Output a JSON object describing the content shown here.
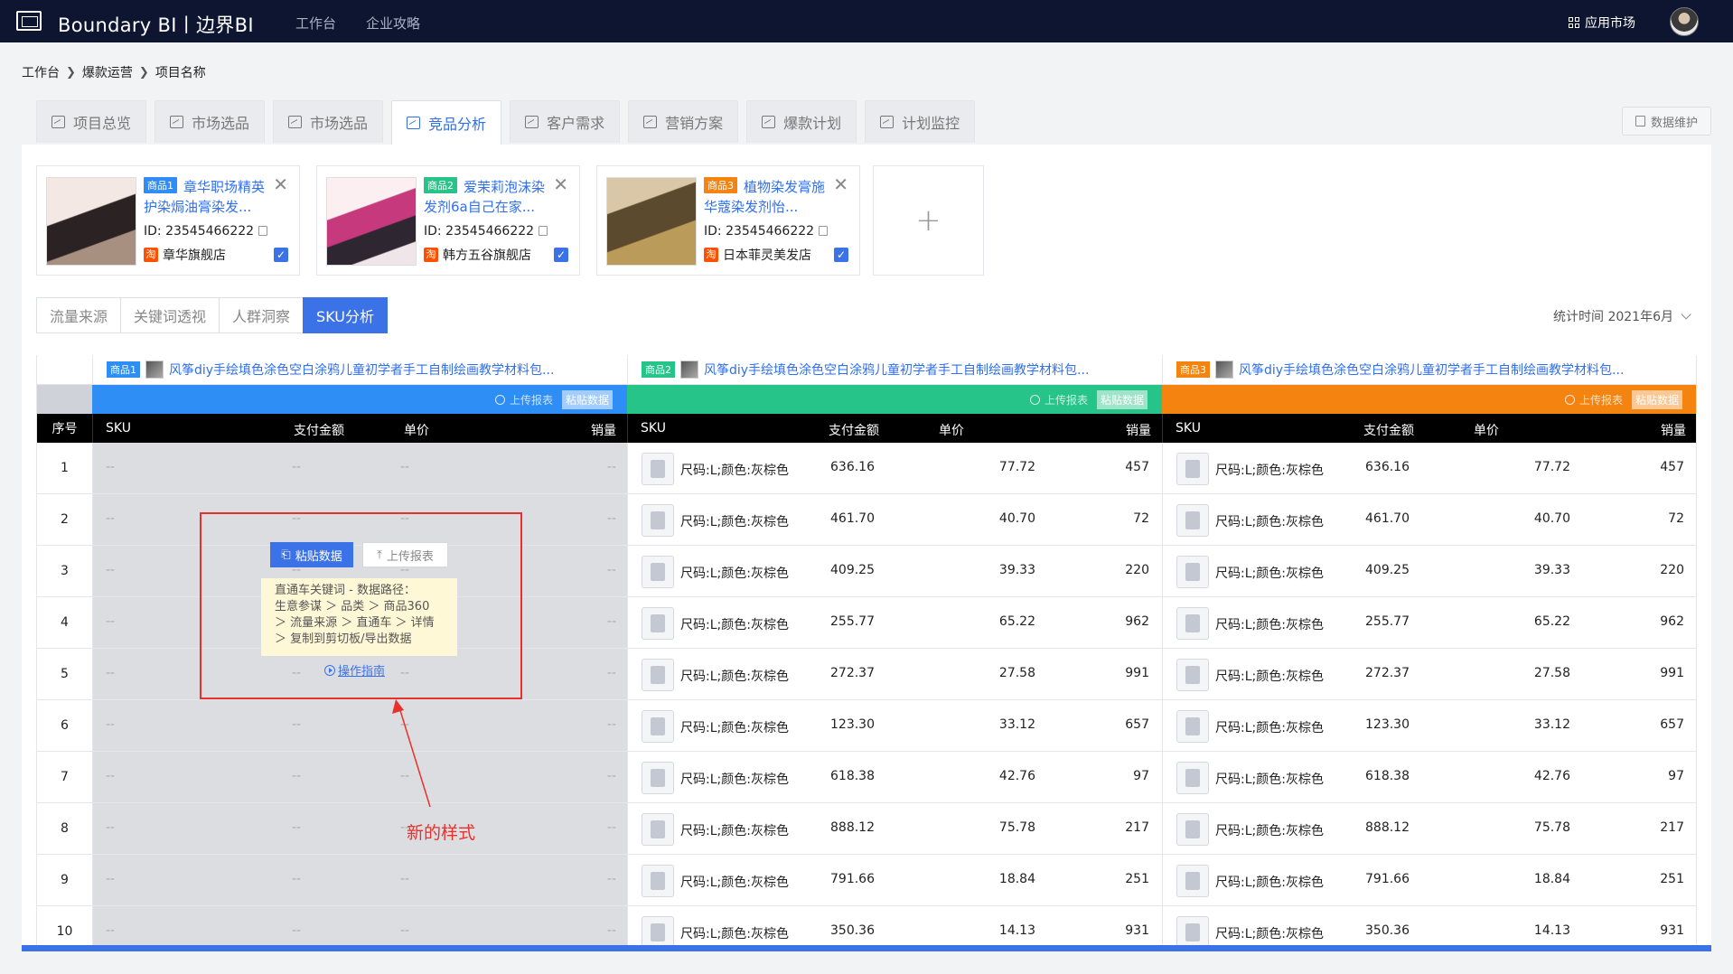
{
  "app": {
    "brand": "Boundary BI丨边界BI",
    "nav": [
      "工作台",
      "企业攻略"
    ],
    "app_market": "应用市场"
  },
  "breadcrumb": [
    "工作台",
    "爆款运营",
    "项目名称"
  ],
  "main_tabs": [
    {
      "label": "项目总览"
    },
    {
      "label": "市场选品"
    },
    {
      "label": "市场选品"
    },
    {
      "label": "竞品分析",
      "active": true
    },
    {
      "label": "客户需求"
    },
    {
      "label": "营销方案"
    },
    {
      "label": "爆款计划"
    },
    {
      "label": "计划监控"
    }
  ],
  "maintenance_button": "数据维护",
  "products": [
    {
      "tag": "商品1",
      "tag_color": "#2f8ef5",
      "title": "章华职场精英护染焗油膏染发...",
      "id": "ID: 23545466222",
      "shop": "章华旗舰店"
    },
    {
      "tag": "商品2",
      "tag_color": "#27c48a",
      "title": "爱茉莉泡沫染发剂6a自己在家...",
      "id": "ID: 23545466222",
      "shop": "韩方五谷旗舰店"
    },
    {
      "tag": "商品3",
      "tag_color": "#f5830f",
      "title": "植物染发膏施华蔻染发剂怡...",
      "id": "ID: 23545466222",
      "shop": "日本菲灵美发店"
    }
  ],
  "taobao_icon_text": "淘",
  "add_product": "+",
  "sub_tabs": [
    {
      "label": "流量来源"
    },
    {
      "label": "关键词透视"
    },
    {
      "label": "人群洞察"
    },
    {
      "label": "SKU分析",
      "active": true
    }
  ],
  "stat_time": "统计时间 2021年6月",
  "table": {
    "seq_header": "序号",
    "columns": [
      "SKU",
      "支付金额",
      "单价",
      "销量"
    ],
    "group_title": "风筝diy手绘填色涂色空白涂鸦儿童初学者手工自制绘画教学材料包...",
    "upload_label": "上传报表",
    "paste_label": "粘贴数据",
    "empty_mark": "--",
    "groups": [
      {
        "tag": "商品1",
        "color": "#2f8ef5",
        "empty": true
      },
      {
        "tag": "商品2",
        "color": "#27c48a",
        "empty": false
      },
      {
        "tag": "商品3",
        "color": "#f5830f",
        "empty": false
      }
    ],
    "rows": [
      {
        "seq": "1",
        "sku": "尺码:L;颜色:灰棕色",
        "amount": "636.16",
        "price": "77.72",
        "sales": "457"
      },
      {
        "seq": "2",
        "sku": "尺码:L;颜色:灰棕色",
        "amount": "461.70",
        "price": "40.70",
        "sales": "72"
      },
      {
        "seq": "3",
        "sku": "尺码:L;颜色:灰棕色",
        "amount": "409.25",
        "price": "39.33",
        "sales": "220"
      },
      {
        "seq": "4",
        "sku": "尺码:L;颜色:灰棕色",
        "amount": "255.77",
        "price": "65.22",
        "sales": "962"
      },
      {
        "seq": "5",
        "sku": "尺码:L;颜色:灰棕色",
        "amount": "272.37",
        "price": "27.58",
        "sales": "991"
      },
      {
        "seq": "6",
        "sku": "尺码:L;颜色:灰棕色",
        "amount": "123.30",
        "price": "33.12",
        "sales": "657"
      },
      {
        "seq": "7",
        "sku": "尺码:L;颜色:灰棕色",
        "amount": "618.38",
        "price": "42.76",
        "sales": "97"
      },
      {
        "seq": "8",
        "sku": "尺码:L;颜色:灰棕色",
        "amount": "888.12",
        "price": "75.78",
        "sales": "217"
      },
      {
        "seq": "9",
        "sku": "尺码:L;颜色:灰棕色",
        "amount": "791.66",
        "price": "18.84",
        "sales": "251"
      },
      {
        "seq": "10",
        "sku": "尺码:L;颜色:灰棕色",
        "amount": "350.36",
        "price": "14.13",
        "sales": "931"
      }
    ]
  },
  "overlay": {
    "paste_button": "粘贴数据",
    "upload_button": "上传报表",
    "tip_lines": [
      "直通车关键词 - 数据路径：",
      "生意参谋 ＞ 品类 ＞ 商品360",
      "＞ 流量来源 ＞ 直通车 ＞ 详情",
      "＞ 复制到剪切板/导出数据"
    ],
    "guide_link": "操作指南",
    "annotation": "新的样式",
    "annotation_color": "#e8312a"
  }
}
